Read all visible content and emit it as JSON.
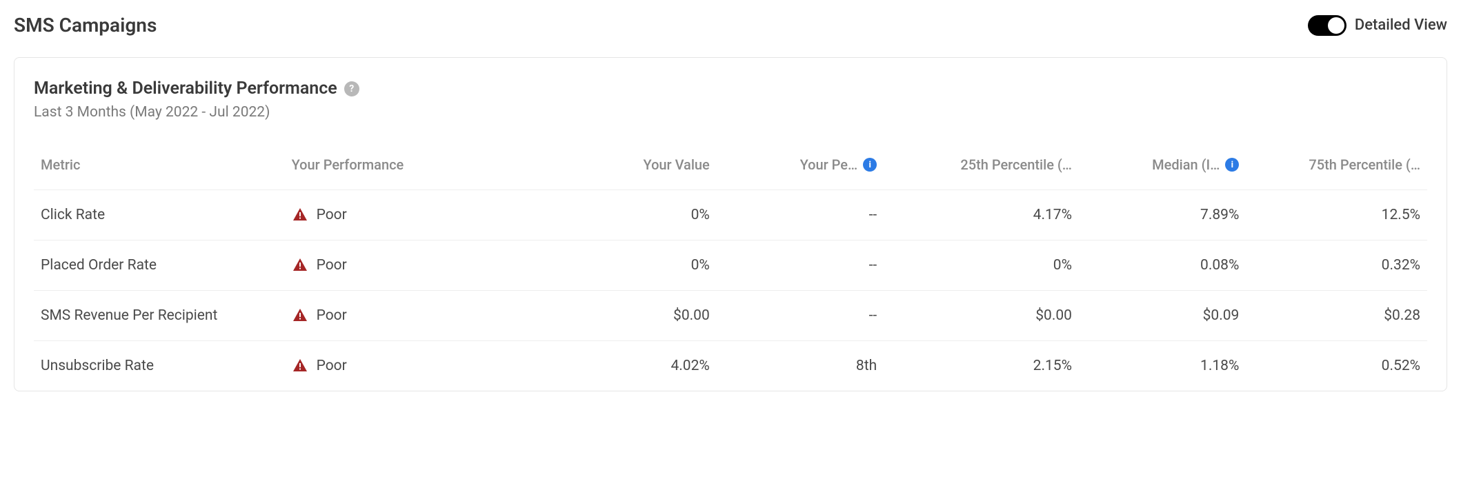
{
  "header": {
    "title": "SMS Campaigns",
    "toggle_label": "Detailed View"
  },
  "card": {
    "title": "Marketing & Deliverability Performance",
    "subtitle": "Last 3 Months (May 2022 - Jul 2022)"
  },
  "columns": {
    "metric": "Metric",
    "performance": "Your Performance",
    "value": "Your Value",
    "percentile": "Your Pe…",
    "p25": "25th Percentile (…",
    "median": "Median (I…",
    "p75": "75th Percentile (…"
  },
  "rows": [
    {
      "metric": "Click Rate",
      "perf_label": "Poor",
      "perf_status": "poor",
      "value": "0%",
      "percentile": "--",
      "p25": "4.17%",
      "median": "7.89%",
      "p75": "12.5%"
    },
    {
      "metric": "Placed Order Rate",
      "perf_label": "Poor",
      "perf_status": "poor",
      "value": "0%",
      "percentile": "--",
      "p25": "0%",
      "median": "0.08%",
      "p75": "0.32%"
    },
    {
      "metric": "SMS Revenue Per Recipient",
      "perf_label": "Poor",
      "perf_status": "poor",
      "value": "$0.00",
      "percentile": "--",
      "p25": "$0.00",
      "median": "$0.09",
      "p75": "$0.28"
    },
    {
      "metric": "Unsubscribe Rate",
      "perf_label": "Poor",
      "perf_status": "poor",
      "value": "4.02%",
      "percentile": "8th",
      "p25": "2.15%",
      "median": "1.18%",
      "p75": "0.52%"
    }
  ]
}
